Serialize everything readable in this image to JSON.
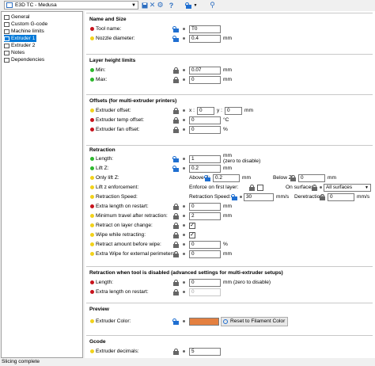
{
  "toolbar": {
    "profile": "E3D TC - Medusa",
    "icons": [
      "save-icon",
      "delete-icon",
      "compare-icon",
      "help-icon",
      "lock-icon",
      "search-icon"
    ]
  },
  "tree": {
    "items": [
      {
        "label": "General",
        "selected": false
      },
      {
        "label": "Custom G-code",
        "selected": false
      },
      {
        "label": "Machine limits",
        "selected": false
      },
      {
        "label": "Extruder 1",
        "selected": true
      },
      {
        "label": "Extruder 2",
        "selected": false
      },
      {
        "label": "Notes",
        "selected": false
      },
      {
        "label": "Dependencies",
        "selected": false
      }
    ]
  },
  "name_size": {
    "title": "Name and Size",
    "tool_name_label": "Tool name:",
    "tool_name_value": "T0",
    "nozzle_label": "Nozzle diameter:",
    "nozzle_value": "0.4",
    "nozzle_unit": "mm"
  },
  "layer_limits": {
    "title": "Layer height limits",
    "min_label": "Min:",
    "min_value": "0.07",
    "min_unit": "mm",
    "max_label": "Max:",
    "max_value": "0",
    "max_unit": "mm"
  },
  "offsets": {
    "title": "Offsets (for multi-extruder printers)",
    "extruder_offset_label": "Extruder offset:",
    "x_label": "x :",
    "x_value": "0",
    "y_label": "y :",
    "y_value": "0",
    "xy_unit": "mm",
    "temp_label": "Extruder temp offset:",
    "temp_value": "0",
    "temp_unit": "°C",
    "fan_label": "Extruder fan offset:",
    "fan_value": "0",
    "fan_unit": "%"
  },
  "retraction": {
    "title": "Retraction",
    "length_label": "Length:",
    "length_value": "1",
    "length_unit": "mm",
    "length_note": "(zero to disable)",
    "lift_label": "Lift Z:",
    "lift_value": "0.2",
    "lift_unit": "mm",
    "only_lift_label": "Only lift Z:",
    "above_label": "Above Z:",
    "above_value": "0.2",
    "above_unit": "mm",
    "below_label": "Below Z:",
    "below_value": "0",
    "below_unit": "mm",
    "lift_enforce_label": "Lift z enforcement:",
    "enforce_first_label": "Enforce on first layer:",
    "on_surfaces_label": "On surfaces:",
    "on_surfaces_value": "All surfaces",
    "speed_label": "Retraction Speed:",
    "speed_inner_label": "Retraction Speed:",
    "speed_value": "30",
    "speed_unit": "mm/s",
    "deretraction_label": "Deretraction:",
    "deretraction_value": "0",
    "deretraction_unit": "mm/s",
    "extra_restart_label": "Extra length on restart:",
    "extra_restart_value": "0",
    "extra_restart_unit": "mm",
    "min_travel_label": "Minimum travel after retraction:",
    "min_travel_value": "2",
    "min_travel_unit": "mm",
    "layer_change_label": "Retract on layer change:",
    "wipe_label": "Wipe while retracting:",
    "amount_label": "Retract amount before wipe:",
    "amount_value": "0",
    "amount_unit": "%",
    "extra_wipe_label": "Extra Wipe for external perimeters:",
    "extra_wipe_value": "0",
    "extra_wipe_unit": "mm"
  },
  "retraction_disabled": {
    "title": "Retraction when tool is disabled (advanced settings for multi-extruder setups)",
    "length_label": "Length:",
    "length_value": "0",
    "length_unit": "mm (zero to disable)",
    "extra_label": "Extra length on restart:",
    "extra_value": "0"
  },
  "preview": {
    "title": "Preview",
    "color_label": "Extruder Color:",
    "color": "#e48040",
    "reset_label": "Reset to Filament Color"
  },
  "gcode": {
    "title": "Gcode",
    "decimals_label": "Extruder decimals:",
    "decimals_value": "5"
  },
  "status": {
    "text": "Slicing complete"
  },
  "colors": {
    "required": "#c8131c",
    "advanced": "#f2d21b",
    "simple": "#2db82d",
    "selection": "#0078d7",
    "unlocked": "#1f6fd1"
  }
}
